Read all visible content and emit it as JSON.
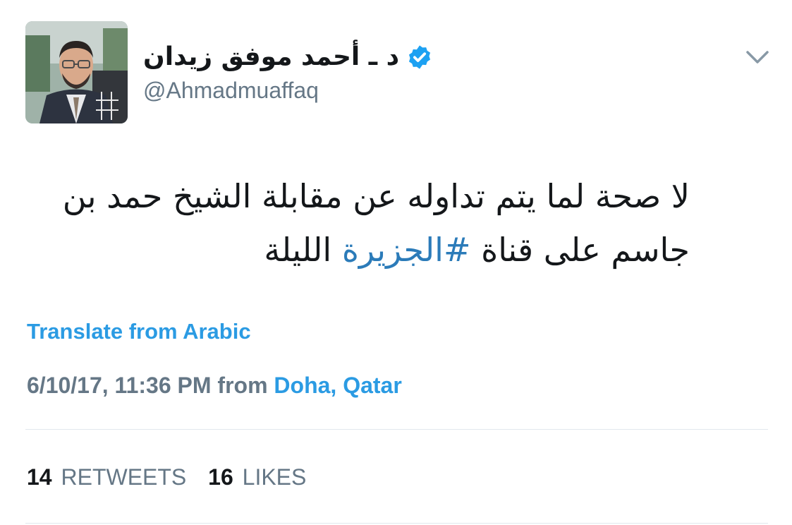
{
  "author": {
    "display_name": "د ـ أحمد موفق زيدان",
    "handle": "@Ahmadmuaffaq",
    "verified": true,
    "avatar_icon": "profile-photo"
  },
  "tweet": {
    "line1": "لا صحة لما يتم تداوله عن مقابلة الشيخ حمد بن",
    "line2_prefix": "جاسم على قناة ",
    "hashtag": "#الجزيرة",
    "line2_suffix": " الليلة"
  },
  "translate_label": "Translate from Arabic",
  "meta": {
    "timestamp": "6/10/17, 11:36 PM",
    "from_label": "from",
    "location": "Doha, Qatar"
  },
  "stats": {
    "retweets_count": "14",
    "retweets_label": "RETWEETS",
    "likes_count": "16",
    "likes_label": "LIKES"
  },
  "colors": {
    "link": "#2b9be3",
    "hashtag": "#2b7bb9",
    "muted": "#657786",
    "text": "#14171a",
    "divider": "#e1e8ed",
    "verified": "#1da1f2"
  }
}
